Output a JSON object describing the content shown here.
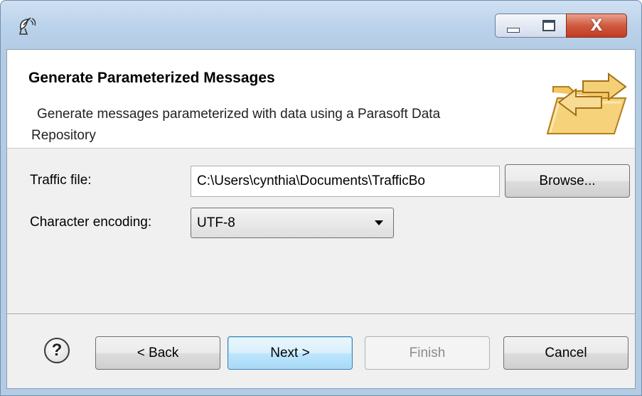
{
  "window": {
    "app_icon": "satellite-dish-icon",
    "controls": {
      "minimize": "minimize-icon",
      "maximize": "maximize-icon",
      "close_glyph": "X"
    }
  },
  "header": {
    "title": "Generate Parameterized Messages",
    "description_line1": "Generate messages parameterized with data using a Parasoft Data",
    "description_line2": "Repository",
    "banner_icon": "folder-exchange-icon"
  },
  "form": {
    "traffic_file_label": "Traffic file:",
    "traffic_file_value": "C:\\Users\\cynthia\\Documents\\TrafficBo",
    "browse_label": "Browse...",
    "encoding_label": "Character encoding:",
    "encoding_value": "UTF-8"
  },
  "footer": {
    "help_glyph": "?",
    "back_label": "< Back",
    "next_label": "Next >",
    "finish_label": "Finish",
    "finish_enabled": false,
    "cancel_label": "Cancel"
  },
  "colors": {
    "accent_next_border": "#3c7fb1",
    "close_button": "#c23b22",
    "title_bar": "#b9d1ea"
  }
}
